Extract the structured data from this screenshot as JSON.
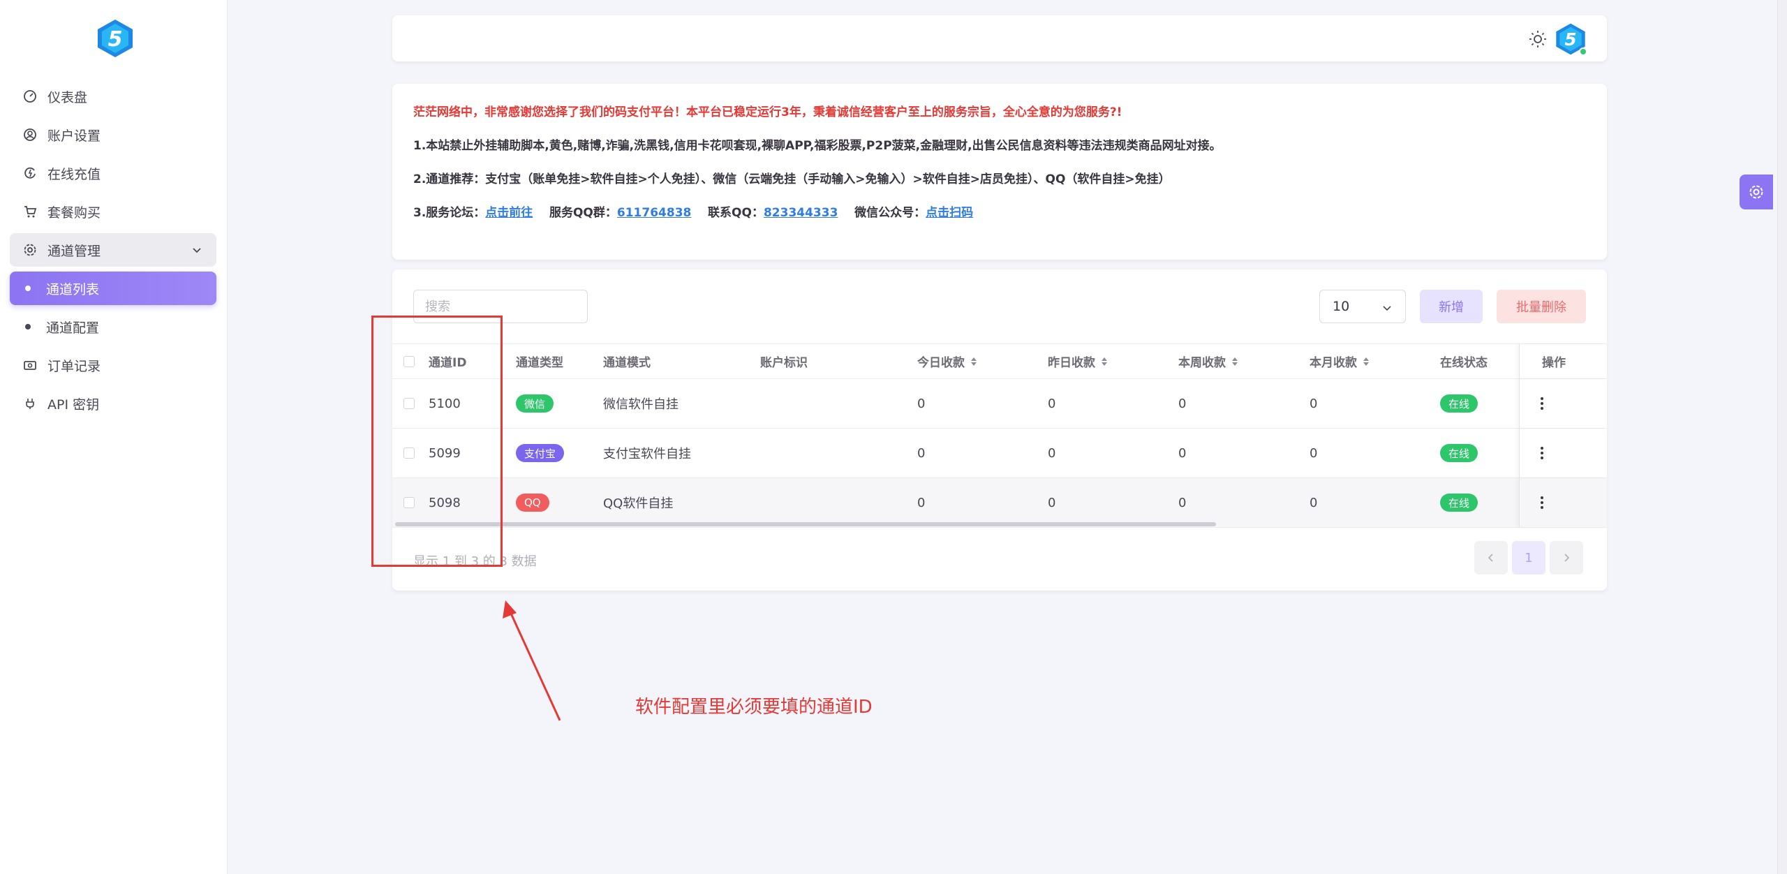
{
  "sidebar": {
    "items": [
      {
        "label": "仪表盘",
        "icon": "dashboard-icon"
      },
      {
        "label": "账户设置",
        "icon": "user-circle-icon"
      },
      {
        "label": "在线充值",
        "icon": "recharge-icon"
      },
      {
        "label": "套餐购买",
        "icon": "cart-icon"
      },
      {
        "label": "通道管理",
        "icon": "gear-icon"
      },
      {
        "label": "通道列表"
      },
      {
        "label": "通道配置"
      },
      {
        "label": "订单记录",
        "icon": "money-icon"
      },
      {
        "label": "API 密钥",
        "icon": "plug-icon"
      }
    ]
  },
  "notice": {
    "line1": "茫茫网络中，非常感谢您选择了我们的码支付平台！本平台已稳定运行3年，秉着诚信经营客户至上的服务宗旨，全心全意的为您服务?!",
    "line2": "1.本站禁止外挂辅助脚本,黄色,赌博,诈骗,洗黑钱,信用卡花呗套现,裸聊APP,福彩股票,P2P菠菜,金融理财,出售公民信息资料等违法违规类商品网址对接。",
    "line3": "2.通道推荐：支付宝（账单免挂>软件自挂>个人免挂）、微信（云端免挂（手动输入>免输入）>软件自挂>店员免挂）、QQ（软件自挂>免挂）",
    "line4_prefix1": "3.服务论坛：",
    "forum_link": "点击前往",
    "line4_prefix2": "服务QQ群：",
    "qq_group": "611764838",
    "line4_prefix3": "联系QQ：",
    "contact_qq": "823344333",
    "line4_prefix4": "微信公众号：",
    "wechat_link": "点击扫码"
  },
  "toolbar": {
    "search_placeholder": "搜索",
    "page_size": "10",
    "add_label": "新增",
    "batch_delete_label": "批量删除"
  },
  "table": {
    "headers": {
      "id": "通道ID",
      "type": "通道类型",
      "mode": "通道模式",
      "account": "账户标识",
      "today": "今日收款",
      "yesterday": "昨日收款",
      "week": "本周收款",
      "month": "本月收款",
      "status": "在线状态",
      "ops": "操作"
    },
    "rows": [
      {
        "id": "5100",
        "type": "微信",
        "mode": "微信软件自挂",
        "account": "",
        "today": "0",
        "yesterday": "0",
        "week": "0",
        "month": "0",
        "status": "在线"
      },
      {
        "id": "5099",
        "type": "支付宝",
        "mode": "支付宝软件自挂",
        "account": "",
        "today": "0",
        "yesterday": "0",
        "week": "0",
        "month": "0",
        "status": "在线"
      },
      {
        "id": "5098",
        "type": "QQ",
        "mode": "QQ软件自挂",
        "account": "",
        "today": "0",
        "yesterday": "0",
        "week": "0",
        "month": "0",
        "status": "在线"
      }
    ],
    "footer": "显示 1 到 3 的 3 数据",
    "current_page": "1"
  },
  "annotation": {
    "note": "软件配置里必须要填的通道ID"
  },
  "colors": {
    "accent": "#8c74f2",
    "success": "#2dc66b",
    "danger": "#e53935",
    "link": "#2f7de1"
  }
}
